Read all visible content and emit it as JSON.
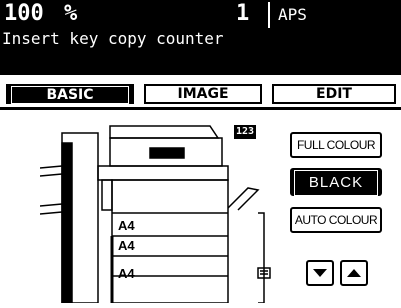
{
  "status": {
    "zoom": "100",
    "zoom_unit": "%",
    "copies": "1",
    "paper_mode": "APS",
    "message": "Insert key copy counter"
  },
  "tabs": [
    {
      "label": "BASIC",
      "active": true
    },
    {
      "label": "IMAGE",
      "active": false
    },
    {
      "label": "EDIT",
      "active": false
    }
  ],
  "color_mode": {
    "full_colour": "FULL COLOUR",
    "black": "BLACK",
    "auto_colour": "AUTO COLOUR",
    "selected": "BLACK"
  },
  "trays": [
    "A4",
    "A4",
    "A4"
  ],
  "counter_icon": "123",
  "icons": {
    "scroll_down": "triangle-down-icon",
    "scroll_up": "triangle-up-icon",
    "list": "list-icon",
    "bypass": "bypass-tray-icon"
  }
}
